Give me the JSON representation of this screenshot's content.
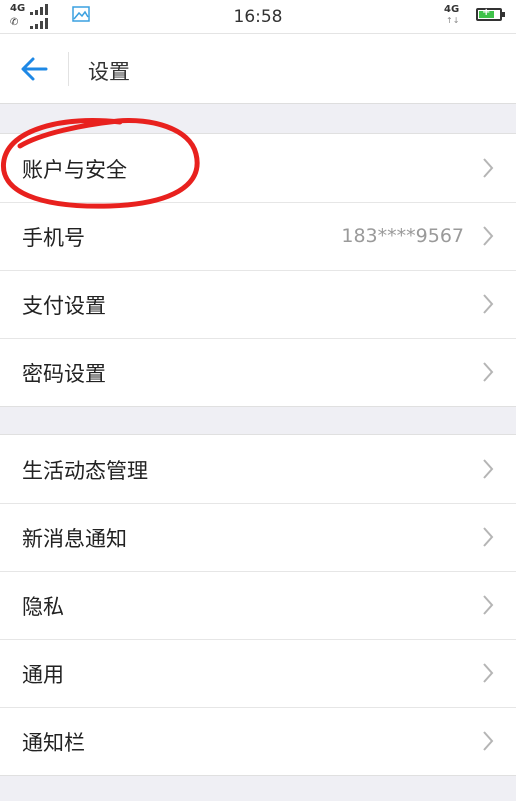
{
  "status_bar": {
    "network_top": "4G",
    "network_bottom": "",
    "time": "16:58",
    "network_right": "4G",
    "battery_level": 0.75,
    "battery_color": "#3fc24a"
  },
  "nav": {
    "title": "设置",
    "accent": "#1e88e5"
  },
  "groups": [
    {
      "items": [
        {
          "label": "账户与安全",
          "value": ""
        },
        {
          "label": "手机号",
          "value": "183****9567"
        },
        {
          "label": "支付设置",
          "value": ""
        },
        {
          "label": "密码设置",
          "value": ""
        }
      ]
    },
    {
      "items": [
        {
          "label": "生活动态管理",
          "value": ""
        },
        {
          "label": "新消息通知",
          "value": ""
        },
        {
          "label": "隐私",
          "value": ""
        },
        {
          "label": "通用",
          "value": ""
        },
        {
          "label": "通知栏",
          "value": ""
        }
      ]
    }
  ],
  "annotation": {
    "color": "#e8211e"
  }
}
